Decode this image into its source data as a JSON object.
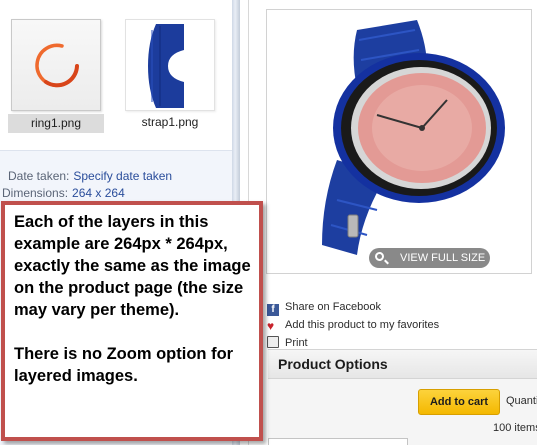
{
  "explorer": {
    "files": [
      {
        "name": "ring1.png",
        "selected": true,
        "thumbnail_icon": "ring-thumbnail-icon"
      },
      {
        "name": "strap1.png",
        "selected": false,
        "thumbnail_icon": "strap-thumbnail-icon"
      }
    ],
    "details": {
      "date_taken_label": "Date taken:",
      "date_taken_value": "Specify date taken",
      "dimensions_label": "Dimensions:",
      "dimensions_value": "264 x 264"
    }
  },
  "product": {
    "image_icon": "watch-product-image",
    "view_full_size": "VIEW FULL SIZE",
    "share_facebook": "Share on Facebook",
    "add_favorites": "Add this product to my favorites",
    "print": "Print",
    "options_title": "Product Options",
    "add_to_cart": "Add to cart",
    "quantity_label": "Quanti",
    "items_count": "100 items"
  },
  "callout": {
    "paragraph1": "Each of the layers in this example are 264px * 264px, exactly the same as the image on the product page (the size may vary per theme).",
    "paragraph2": "There is no Zoom option for layered images."
  },
  "colors": {
    "callout_border": "#c0504d",
    "add_to_cart_bg": "#f4b800",
    "strap_blue": "#1c3c9c"
  }
}
